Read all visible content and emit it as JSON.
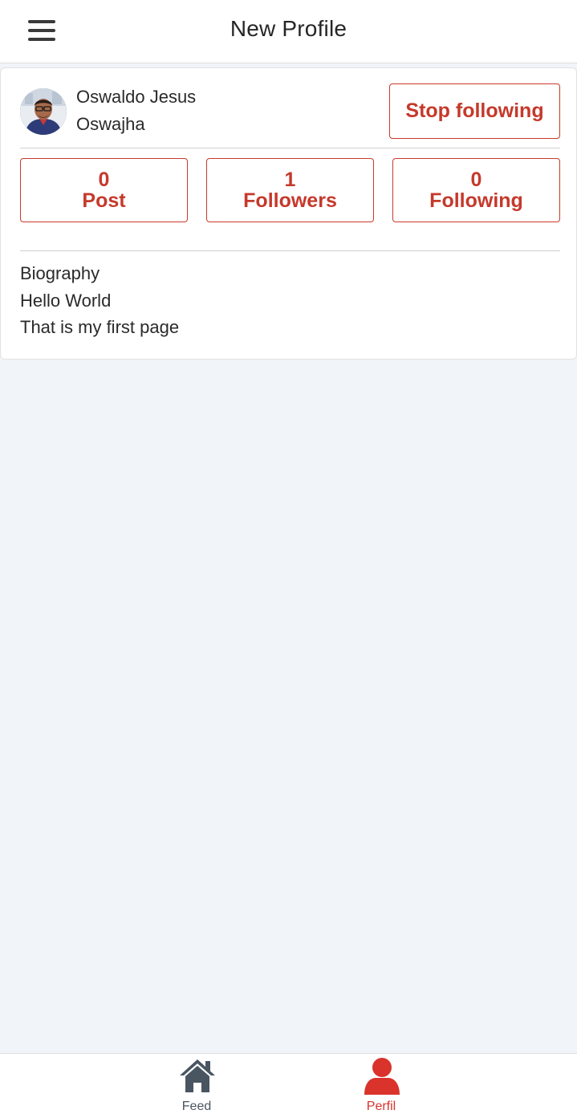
{
  "header": {
    "title": "New Profile",
    "menu_icon": "hamburger-menu-icon"
  },
  "profile": {
    "name": "Oswaldo Jesus",
    "username": "Oswajha",
    "follow_button_label": "Stop following"
  },
  "stats": [
    {
      "count": "0",
      "label": "Post"
    },
    {
      "count": "1",
      "label": "Followers"
    },
    {
      "count": "0",
      "label": "Following"
    }
  ],
  "bio": {
    "title": "Biography",
    "lines": [
      "Hello World",
      "That is my first page"
    ]
  },
  "bottom_nav": {
    "items": [
      {
        "label": "Feed",
        "icon": "home-icon",
        "active": false
      },
      {
        "label": "Perfil",
        "icon": "user-icon",
        "active": true
      }
    ]
  },
  "colors": {
    "accent": "#c5392b",
    "nav_active": "#d9332b",
    "nav_inactive": "#4a5562",
    "background": "#f1f4f9"
  }
}
